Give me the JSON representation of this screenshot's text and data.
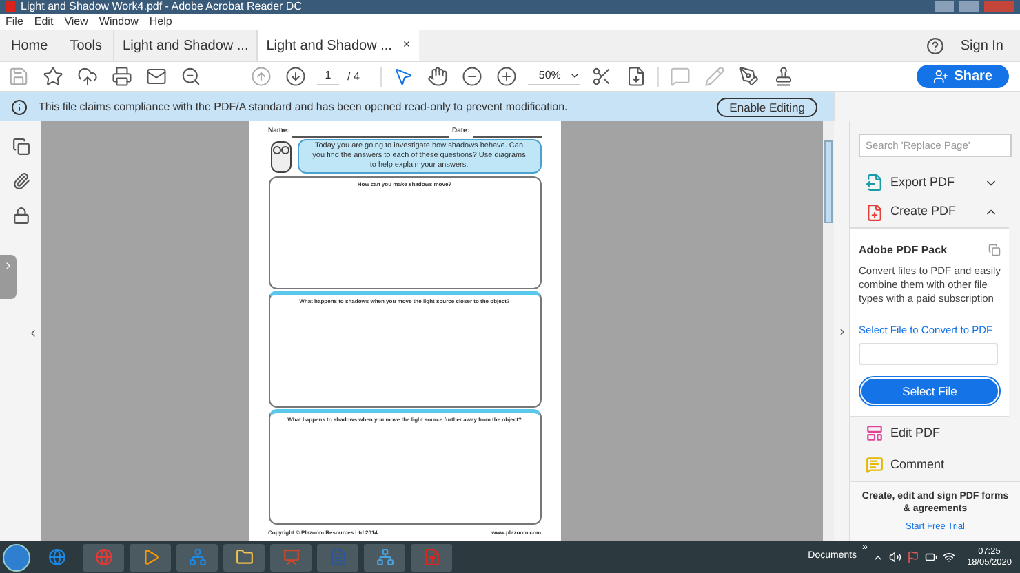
{
  "window": {
    "title": "Light and Shadow Work4.pdf - Adobe Acrobat Reader DC"
  },
  "menu": [
    "File",
    "Edit",
    "View",
    "Window",
    "Help"
  ],
  "tabs": [
    {
      "label": "Home",
      "kind": "nav",
      "selected": false
    },
    {
      "label": "Tools",
      "kind": "nav",
      "selected": false
    },
    {
      "label": "Light and Shadow ...",
      "kind": "doc",
      "selected": false
    },
    {
      "label": "Light and Shadow ...",
      "kind": "doc",
      "selected": true,
      "close": "×"
    }
  ],
  "account": {
    "sign_in": "Sign In"
  },
  "toolbar": {
    "page": "1",
    "page_count": "/ 4",
    "zoom": "50%",
    "share": "Share"
  },
  "info_bar": {
    "message": "This file claims compliance with the PDF/A standard and has been opened read-only to prevent modification.",
    "button": "Enable Editing"
  },
  "document": {
    "name_label": "Name:",
    "date_label": "Date:",
    "intro": "Today you are going to investigate how shadows behave. Can you find the answers to each of these questions? Use diagrams to help explain your answers.",
    "questions": [
      "How can you make shadows move?",
      "What happens to shadows when you move the light source closer to the object?",
      "What happens to shadows when you move the light source further away from the object?"
    ],
    "footer_left": "Copyright © Plazoom Resources Ltd 2014",
    "footer_right": "www.plazoom.com"
  },
  "right_panel": {
    "search": {
      "placeholder": "Search 'Replace Page'"
    },
    "tools": [
      {
        "label": "Export PDF",
        "kind": "export",
        "expanded": false
      },
      {
        "label": "Create PDF",
        "kind": "create",
        "expanded": true
      }
    ],
    "card": {
      "title": "Adobe PDF Pack",
      "description": "Convert files to PDF and easily combine them with other file types with a paid subscription",
      "link": "Select File to Convert to PDF",
      "button": "Select File"
    },
    "more_tools": [
      {
        "label": "Edit PDF",
        "kind": "edit"
      },
      {
        "label": "Comment",
        "kind": "comment"
      }
    ],
    "promo": {
      "text": "Create, edit and sign PDF forms & agreements",
      "link": "Start Free Trial"
    }
  },
  "taskbar": {
    "toolbar_label": "Documents",
    "chevron": "»",
    "time": "07:25",
    "date": "18/05/2020"
  }
}
